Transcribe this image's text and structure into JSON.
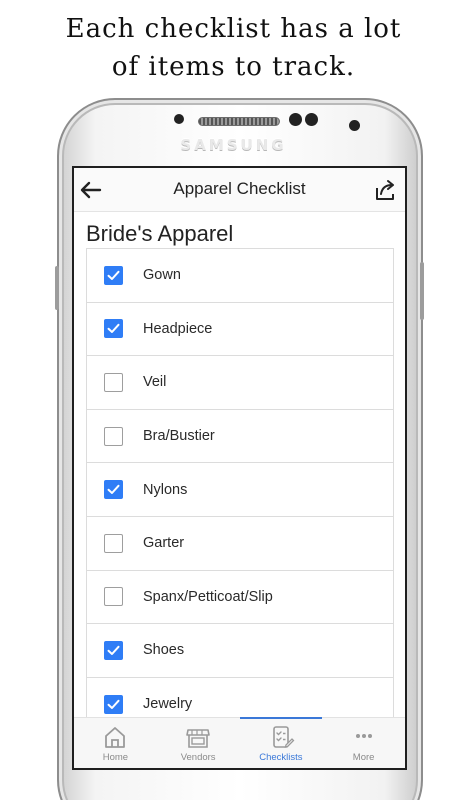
{
  "headline": {
    "line1": "Each checklist has a lot",
    "line2": "of items to track."
  },
  "device": {
    "brand": "SAMSUNG"
  },
  "appbar": {
    "title": "Apparel Checklist",
    "back_icon": "arrow-left-icon",
    "share_icon": "share-icon"
  },
  "section": {
    "title": "Bride's Apparel"
  },
  "items": [
    {
      "label": "Gown",
      "checked": true
    },
    {
      "label": "Headpiece",
      "checked": true
    },
    {
      "label": "Veil",
      "checked": false
    },
    {
      "label": "Bra/Bustier",
      "checked": false
    },
    {
      "label": "Nylons",
      "checked": true
    },
    {
      "label": "Garter",
      "checked": false
    },
    {
      "label": "Spanx/Petticoat/Slip",
      "checked": false
    },
    {
      "label": "Shoes",
      "checked": true
    },
    {
      "label": "Jewelry",
      "checked": true
    }
  ],
  "tabs": [
    {
      "label": "Home",
      "icon": "home-icon",
      "active": false
    },
    {
      "label": "Vendors",
      "icon": "store-icon",
      "active": false
    },
    {
      "label": "Checklists",
      "icon": "checklist-icon",
      "active": true
    },
    {
      "label": "More",
      "icon": "more-dots-icon",
      "active": false
    }
  ],
  "colors": {
    "accent": "#3a78d8",
    "checkbox_checked": "#2f7df6"
  }
}
